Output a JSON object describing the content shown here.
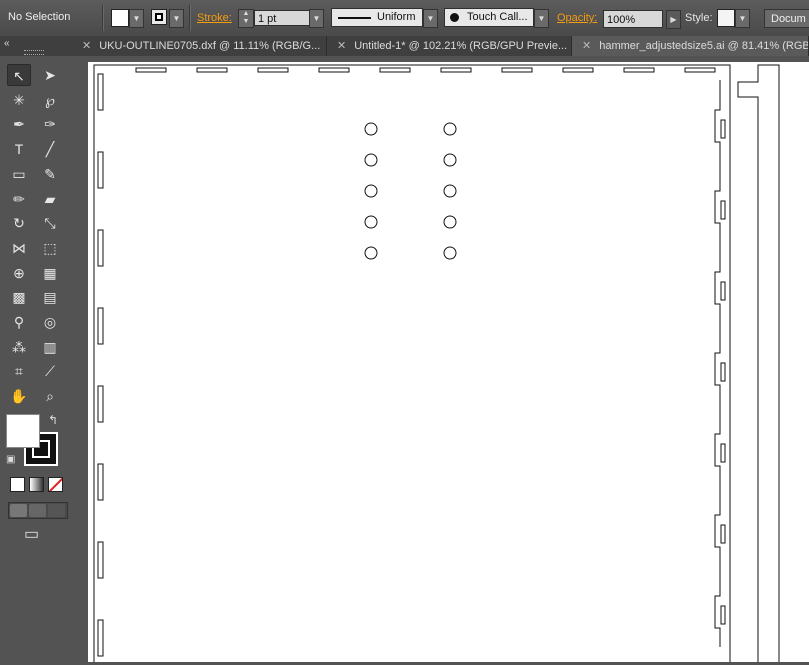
{
  "control_bar": {
    "selection": "No Selection",
    "stroke_label": "Stroke:",
    "stroke_weight": "1 pt",
    "profile": "Uniform",
    "brush": "Touch Call...",
    "opacity_label": "Opacity:",
    "opacity": "100%",
    "style_label": "Style:",
    "document_button": "Docum"
  },
  "tabs": [
    {
      "label": "UKU-OUTLINE0705.dxf @ 11.11% (RGB/G..."
    },
    {
      "label": "Untitled-1* @ 102.21% (RGB/GPU Previe..."
    },
    {
      "label": "hammer_adjustedsize5.ai @ 81.41% (RGB/"
    }
  ],
  "toolbox": {
    "collapse_glyph": "«",
    "tools": [
      {
        "name": "selection-tool-icon",
        "glyph": "↖"
      },
      {
        "name": "direct-selection-tool-icon",
        "glyph": "➤"
      },
      {
        "name": "magic-wand-tool-icon",
        "glyph": "✳"
      },
      {
        "name": "lasso-tool-icon",
        "glyph": "℘"
      },
      {
        "name": "pen-tool-icon",
        "glyph": "✒"
      },
      {
        "name": "curvature-tool-icon",
        "glyph": "✑"
      },
      {
        "name": "type-tool-icon",
        "glyph": "T"
      },
      {
        "name": "line-segment-tool-icon",
        "glyph": "╱"
      },
      {
        "name": "rectangle-tool-icon",
        "glyph": "▭"
      },
      {
        "name": "paintbrush-tool-icon",
        "glyph": "✎"
      },
      {
        "name": "pencil-tool-icon",
        "glyph": "✏"
      },
      {
        "name": "eraser-tool-icon",
        "glyph": "▰"
      },
      {
        "name": "rotate-tool-icon",
        "glyph": "↻"
      },
      {
        "name": "scale-tool-icon",
        "glyph": "⤡"
      },
      {
        "name": "width-tool-icon",
        "glyph": "⋈"
      },
      {
        "name": "free-transform-tool-icon",
        "glyph": "⬚"
      },
      {
        "name": "shape-builder-tool-icon",
        "glyph": "⊕"
      },
      {
        "name": "perspective-grid-tool-icon",
        "glyph": "▦"
      },
      {
        "name": "mesh-tool-icon",
        "glyph": "▩"
      },
      {
        "name": "gradient-tool-icon",
        "glyph": "▤"
      },
      {
        "name": "eyedropper-tool-icon",
        "glyph": "⚲"
      },
      {
        "name": "blend-tool-icon",
        "glyph": "◎"
      },
      {
        "name": "symbol-sprayer-tool-icon",
        "glyph": "⁂"
      },
      {
        "name": "column-graph-tool-icon",
        "glyph": "▥"
      },
      {
        "name": "artboard-tool-icon",
        "glyph": "⌗"
      },
      {
        "name": "slice-tool-icon",
        "glyph": "⟋"
      },
      {
        "name": "hand-tool-icon",
        "glyph": "✋"
      },
      {
        "name": "zoom-tool-icon",
        "glyph": "⌕"
      }
    ],
    "swap_glyph": "↰",
    "default_glyph": "▣",
    "screen_mode_glyph": "▭"
  },
  "colors": {
    "fill": "#ffffff",
    "stroke": "#000000",
    "accent_orange": "#f39c12",
    "none_red": "#e02020"
  }
}
